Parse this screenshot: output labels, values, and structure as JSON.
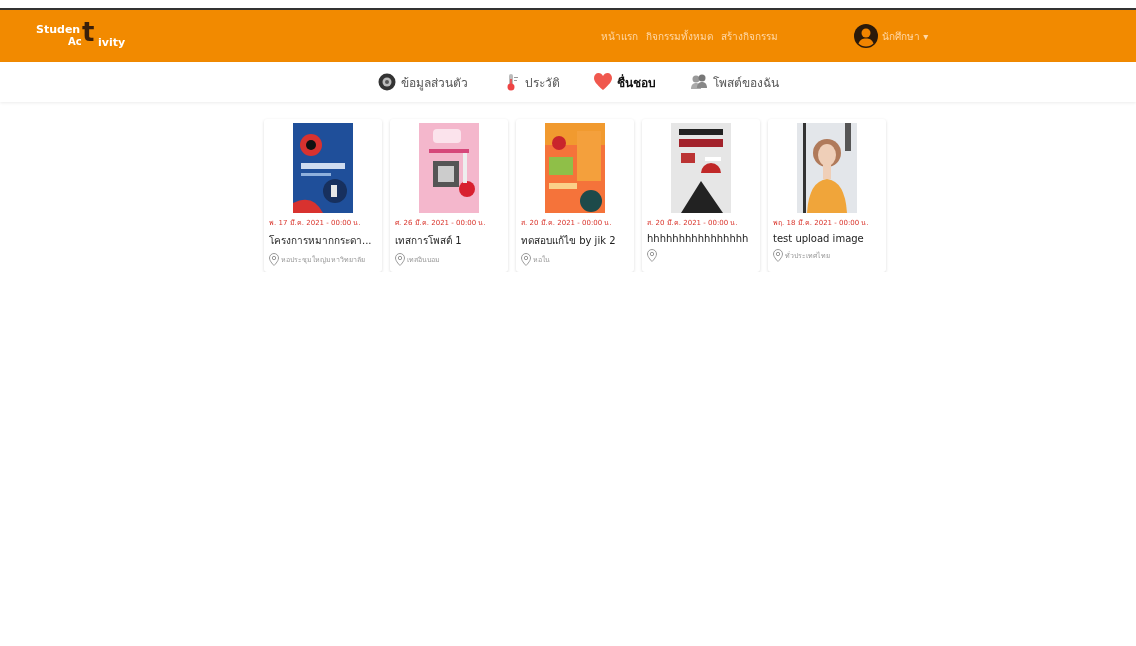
{
  "header": {
    "logo": {
      "top": "Studen",
      "big": "t",
      "bottom_left": "Ac",
      "bottom_right": "ivity"
    },
    "nav": [
      {
        "label": "หน้าแรก"
      },
      {
        "label": "กิจกรรมทั้งหมด"
      },
      {
        "label": "สร้างกิจกรรม"
      }
    ],
    "user": {
      "name": "นักศึกษา",
      "caret": "▾"
    }
  },
  "tabs": [
    {
      "label": "ข้อมูลส่วนตัว",
      "selected": false
    },
    {
      "label": "ประวัติ",
      "selected": false
    },
    {
      "label": "ชื่นชอบ",
      "selected": true
    },
    {
      "label": "โพสต์ของฉัน",
      "selected": false
    }
  ],
  "cards": [
    {
      "date": "พ. 17 มี.ค. 2021 - 00:00 น.",
      "title": "โครงการหมากกระดา...",
      "location": "หอประชุมใหญ่มหาวิทยาลัย"
    },
    {
      "date": "ศ. 26 มี.ค. 2021 - 00:00 น.",
      "title": "เทสการโพสต์ 1",
      "location": "เทสอินบอม"
    },
    {
      "date": "ส. 20 มี.ค. 2021 - 00:00 น.",
      "title": "ทดสอบแก้ไข by jik 2",
      "location": "หอใน"
    },
    {
      "date": "ส. 20 มี.ค. 2021 - 00:00 น.",
      "title": "hhhhhhhhhhhhhhhh"
    },
    {
      "date": "พฤ. 18 มี.ค. 2021 - 00:00 น.",
      "title": "test upload image",
      "location": "ทั่วประเทศไทย"
    }
  ]
}
